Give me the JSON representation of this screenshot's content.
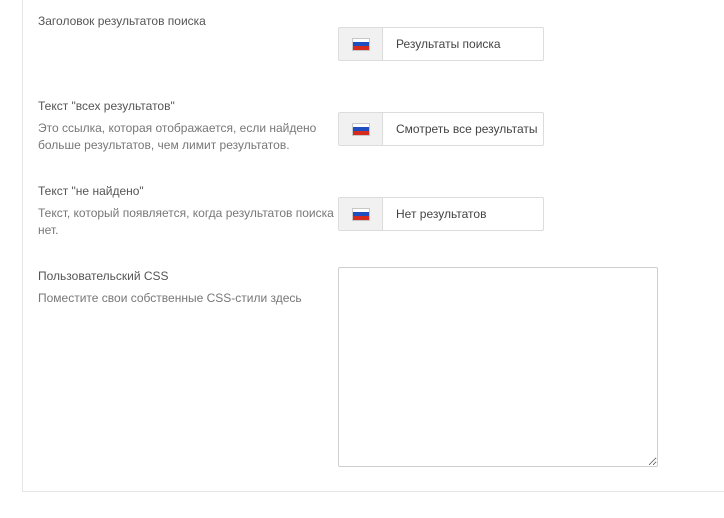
{
  "fields": [
    {
      "label": "Заголовок результатов поиска",
      "description": "",
      "value": "Результаты поиска"
    },
    {
      "label": "Текст \"всех результатов\"",
      "description": "Это ссылка, которая отображается, если найдено больше результатов, чем лимит результатов.",
      "value": "Смотреть все результаты"
    },
    {
      "label": "Текст \"не найдено\"",
      "description": "Текст, который появляется, когда результатов поиска нет.",
      "value": "Нет результатов"
    }
  ],
  "custom_css": {
    "label": "Пользовательский CSS",
    "description": "Поместите свои собственные CSS-стили здесь",
    "value": ""
  },
  "language_flag": {
    "icon": "russia-flag-icon",
    "colors": [
      "#ffffff",
      "#1f4fbf",
      "#d52b1e"
    ]
  }
}
